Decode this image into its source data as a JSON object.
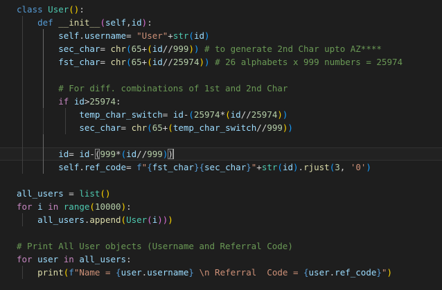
{
  "editor": {
    "language": "python",
    "colors": {
      "background": "#1e1e1e",
      "keyword": "#569cd6",
      "control": "#c586c0",
      "class_name": "#4ec9b0",
      "function": "#dcdcaa",
      "variable": "#9cdcfe",
      "number": "#b5cea8",
      "string": "#ce9178",
      "comment": "#6a9955",
      "bracket_1": "#ffd700",
      "bracket_2": "#da70d6",
      "bracket_3": "#179fff"
    },
    "cursor_line": 12,
    "lines": [
      {
        "indent": 0,
        "tokens": [
          [
            "kw",
            "class"
          ],
          [
            "op",
            " "
          ],
          [
            "cls",
            "User"
          ],
          [
            "b1",
            "()"
          ],
          [
            "op",
            ":"
          ]
        ]
      },
      {
        "indent": 1,
        "tokens": [
          [
            "kw",
            "def"
          ],
          [
            "op",
            " "
          ],
          [
            "fn",
            "__init__"
          ],
          [
            "b2",
            "("
          ],
          [
            "var",
            "self"
          ],
          [
            "op",
            ","
          ],
          [
            "var",
            "id"
          ],
          [
            "b2",
            ")"
          ],
          [
            "op",
            ":"
          ]
        ]
      },
      {
        "indent": 2,
        "tokens": [
          [
            "var",
            "self"
          ],
          [
            "op",
            "."
          ],
          [
            "var",
            "username"
          ],
          [
            "op",
            "= "
          ],
          [
            "str",
            "\"User\""
          ],
          [
            "op",
            "+"
          ],
          [
            "cls",
            "str"
          ],
          [
            "b3",
            "("
          ],
          [
            "var",
            "id"
          ],
          [
            "b3",
            ")"
          ]
        ]
      },
      {
        "indent": 2,
        "tokens": [
          [
            "var",
            "sec_char"
          ],
          [
            "op",
            "= "
          ],
          [
            "fn",
            "chr"
          ],
          [
            "b3",
            "("
          ],
          [
            "num",
            "65"
          ],
          [
            "op",
            "+"
          ],
          [
            "b1",
            "("
          ],
          [
            "var",
            "id"
          ],
          [
            "op",
            "//"
          ],
          [
            "num",
            "999"
          ],
          [
            "b1",
            ")"
          ],
          [
            "b3",
            ")"
          ],
          [
            "op",
            " "
          ],
          [
            "com",
            "# to generate 2nd Char upto AZ****"
          ]
        ]
      },
      {
        "indent": 2,
        "tokens": [
          [
            "var",
            "fst_char"
          ],
          [
            "op",
            "= "
          ],
          [
            "fn",
            "chr"
          ],
          [
            "b3",
            "("
          ],
          [
            "num",
            "65"
          ],
          [
            "op",
            "+"
          ],
          [
            "b1",
            "("
          ],
          [
            "var",
            "id"
          ],
          [
            "op",
            "//"
          ],
          [
            "num",
            "25974"
          ],
          [
            "b1",
            ")"
          ],
          [
            "b3",
            ")"
          ],
          [
            "op",
            " "
          ],
          [
            "com",
            "# 26 alphabets x 999 numbers = 25974"
          ]
        ]
      },
      {
        "indent": 2,
        "tokens": []
      },
      {
        "indent": 2,
        "tokens": [
          [
            "com",
            "# For diff. combinations of 1st and 2nd Char"
          ]
        ]
      },
      {
        "indent": 2,
        "tokens": [
          [
            "ctl",
            "if"
          ],
          [
            "op",
            " "
          ],
          [
            "var",
            "id"
          ],
          [
            "op",
            ">"
          ],
          [
            "num",
            "25974"
          ],
          [
            "op",
            ":"
          ]
        ]
      },
      {
        "indent": 3,
        "tokens": [
          [
            "var",
            "temp_char_switch"
          ],
          [
            "op",
            "= "
          ],
          [
            "var",
            "id"
          ],
          [
            "op",
            "-"
          ],
          [
            "b3",
            "("
          ],
          [
            "num",
            "25974"
          ],
          [
            "op",
            "*"
          ],
          [
            "b1",
            "("
          ],
          [
            "var",
            "id"
          ],
          [
            "op",
            "//"
          ],
          [
            "num",
            "25974"
          ],
          [
            "b1",
            ")"
          ],
          [
            "b3",
            ")"
          ]
        ]
      },
      {
        "indent": 3,
        "tokens": [
          [
            "var",
            "sec_char"
          ],
          [
            "op",
            "= "
          ],
          [
            "fn",
            "chr"
          ],
          [
            "b3",
            "("
          ],
          [
            "num",
            "65"
          ],
          [
            "op",
            "+"
          ],
          [
            "b1",
            "("
          ],
          [
            "var",
            "temp_char_switch"
          ],
          [
            "op",
            "//"
          ],
          [
            "num",
            "999"
          ],
          [
            "b1",
            ")"
          ],
          [
            "b3",
            ")"
          ]
        ]
      },
      {
        "indent": 2,
        "tokens": []
      },
      {
        "indent": 2,
        "tokens": [
          [
            "var",
            "id"
          ],
          [
            "op",
            "= "
          ],
          [
            "var",
            "id"
          ],
          [
            "op",
            "-"
          ],
          [
            "bm",
            "("
          ],
          [
            "num",
            "999"
          ],
          [
            "op",
            "*"
          ],
          [
            "b3",
            "("
          ],
          [
            "var",
            "id"
          ],
          [
            "op",
            "//"
          ],
          [
            "num",
            "999"
          ],
          [
            "b3",
            ")"
          ],
          [
            "bm",
            ")"
          ],
          [
            "cursor",
            ""
          ]
        ]
      },
      {
        "indent": 2,
        "tokens": [
          [
            "var",
            "self"
          ],
          [
            "op",
            "."
          ],
          [
            "var",
            "ref_code"
          ],
          [
            "op",
            "= "
          ],
          [
            "kw",
            "f"
          ],
          [
            "str",
            "\""
          ],
          [
            "kw",
            "{"
          ],
          [
            "var",
            "fst_char"
          ],
          [
            "kw",
            "}{"
          ],
          [
            "var",
            "sec_char"
          ],
          [
            "kw",
            "}"
          ],
          [
            "str",
            "\""
          ],
          [
            "op",
            "+"
          ],
          [
            "cls",
            "str"
          ],
          [
            "b3",
            "("
          ],
          [
            "var",
            "id"
          ],
          [
            "b3",
            ")"
          ],
          [
            "op",
            "."
          ],
          [
            "fn",
            "rjust"
          ],
          [
            "b3",
            "("
          ],
          [
            "num",
            "3"
          ],
          [
            "op",
            ", "
          ],
          [
            "str",
            "'0'"
          ],
          [
            "b3",
            ")"
          ]
        ]
      },
      {
        "indent": 0,
        "tokens": []
      },
      {
        "indent": 0,
        "tokens": [
          [
            "var",
            "all_users"
          ],
          [
            "op",
            " = "
          ],
          [
            "cls",
            "list"
          ],
          [
            "b1",
            "()"
          ]
        ]
      },
      {
        "indent": 0,
        "tokens": [
          [
            "ctl",
            "for"
          ],
          [
            "op",
            " "
          ],
          [
            "var",
            "i"
          ],
          [
            "op",
            " "
          ],
          [
            "ctl",
            "in"
          ],
          [
            "op",
            " "
          ],
          [
            "cls",
            "range"
          ],
          [
            "b1",
            "("
          ],
          [
            "num",
            "10000"
          ],
          [
            "b1",
            ")"
          ],
          [
            "op",
            ":"
          ]
        ]
      },
      {
        "indent": 1,
        "tokens": [
          [
            "var",
            "all_users"
          ],
          [
            "op",
            "."
          ],
          [
            "fn",
            "append"
          ],
          [
            "b1",
            "("
          ],
          [
            "cls",
            "User"
          ],
          [
            "b2",
            "("
          ],
          [
            "var",
            "i"
          ],
          [
            "b2",
            "))"
          ],
          [
            "b1",
            ")"
          ]
        ]
      },
      {
        "indent": 0,
        "tokens": []
      },
      {
        "indent": 0,
        "tokens": [
          [
            "com",
            "# Print All User objects (Username and Referral Code)"
          ]
        ]
      },
      {
        "indent": 0,
        "tokens": [
          [
            "ctl",
            "for"
          ],
          [
            "op",
            " "
          ],
          [
            "var",
            "user"
          ],
          [
            "op",
            " "
          ],
          [
            "ctl",
            "in"
          ],
          [
            "op",
            " "
          ],
          [
            "var",
            "all_users"
          ],
          [
            "op",
            ":"
          ]
        ]
      },
      {
        "indent": 1,
        "tokens": [
          [
            "fn",
            "print"
          ],
          [
            "b1",
            "("
          ],
          [
            "kw",
            "f"
          ],
          [
            "str",
            "\"Name = "
          ],
          [
            "kw",
            "{"
          ],
          [
            "var",
            "user"
          ],
          [
            "op",
            "."
          ],
          [
            "var",
            "username"
          ],
          [
            "kw",
            "}"
          ],
          [
            "str",
            " \\n Referral  Code = "
          ],
          [
            "kw",
            "{"
          ],
          [
            "var",
            "user"
          ],
          [
            "op",
            "."
          ],
          [
            "var",
            "ref_code"
          ],
          [
            "kw",
            "}"
          ],
          [
            "str",
            "\""
          ],
          [
            "b1",
            ")"
          ]
        ]
      }
    ]
  }
}
